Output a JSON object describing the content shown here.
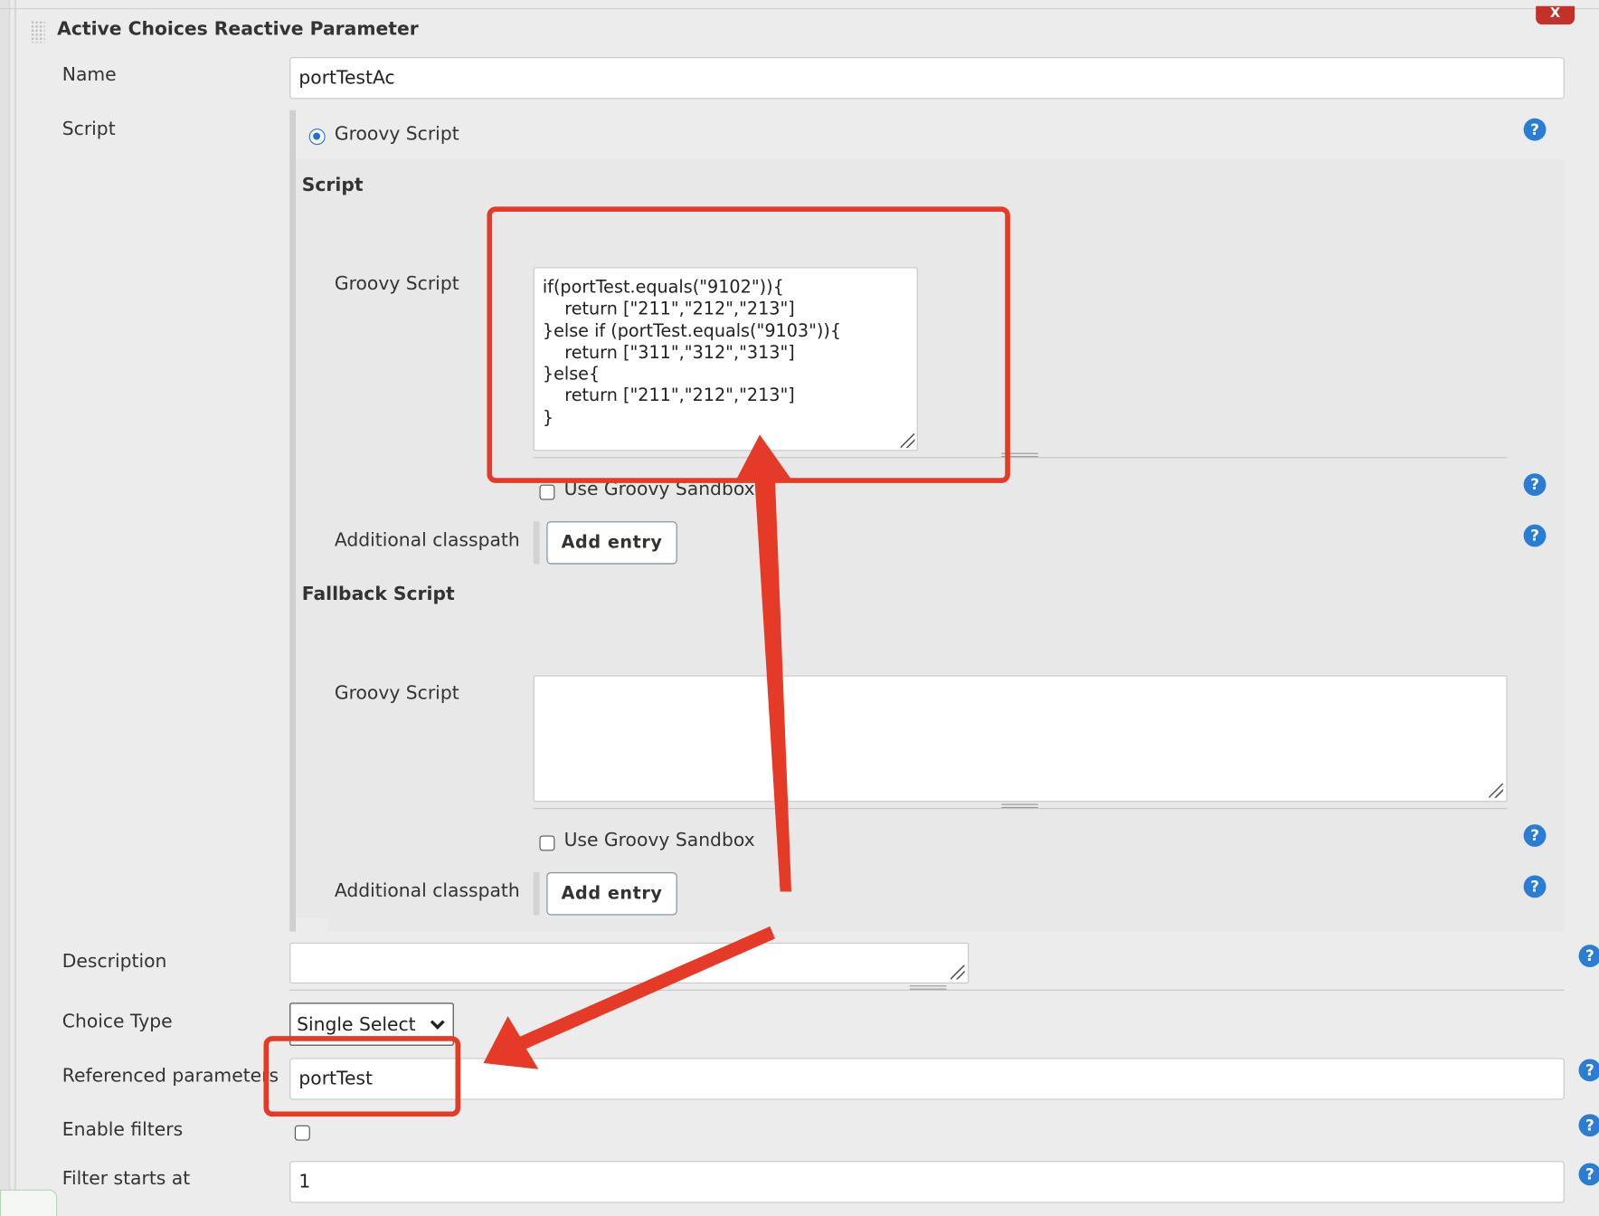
{
  "header": {
    "title": "Active Choices Reactive Parameter",
    "close_label": "X"
  },
  "fields": {
    "name_label": "Name",
    "name_value": "portTestAc",
    "script_label": "Script",
    "description_label": "Description",
    "description_value": "",
    "choice_type_label": "Choice Type",
    "choice_type_value": "Single Select",
    "referenced_label": "Referenced parameters",
    "referenced_value": "portTest",
    "enable_filters_label": "Enable filters",
    "filter_starts_label": "Filter starts at",
    "filter_starts_value": "1"
  },
  "script": {
    "radio_label": "Groovy Script",
    "script_section": "Script",
    "groovy_label": "Groovy Script",
    "code_lines": [
      "if(portTest.equals(\"9102\")){",
      "    return [\"211\",\"212\",\"213\"]",
      "}else if (portTest.equals(\"9103\")){",
      "    return [\"311\",\"312\",\"313\"]",
      "}else{",
      "    return [\"211\",\"212\",\"213\"]",
      "}"
    ],
    "sandbox_label": "Use Groovy Sandbox",
    "classpath_label": "Additional classpath",
    "add_entry_label": "Add entry",
    "fallback_section": "Fallback Script",
    "fallback_groovy_label": "Groovy Script",
    "fallback_code": "",
    "fallback_sandbox_label": "Use Groovy Sandbox",
    "fallback_classpath_label": "Additional classpath",
    "fallback_add_entry_label": "Add entry"
  },
  "help_glyph": "?",
  "colors": {
    "annotation": "#e53a27",
    "accent": "#2b7cd4",
    "close": "#c4312b"
  }
}
